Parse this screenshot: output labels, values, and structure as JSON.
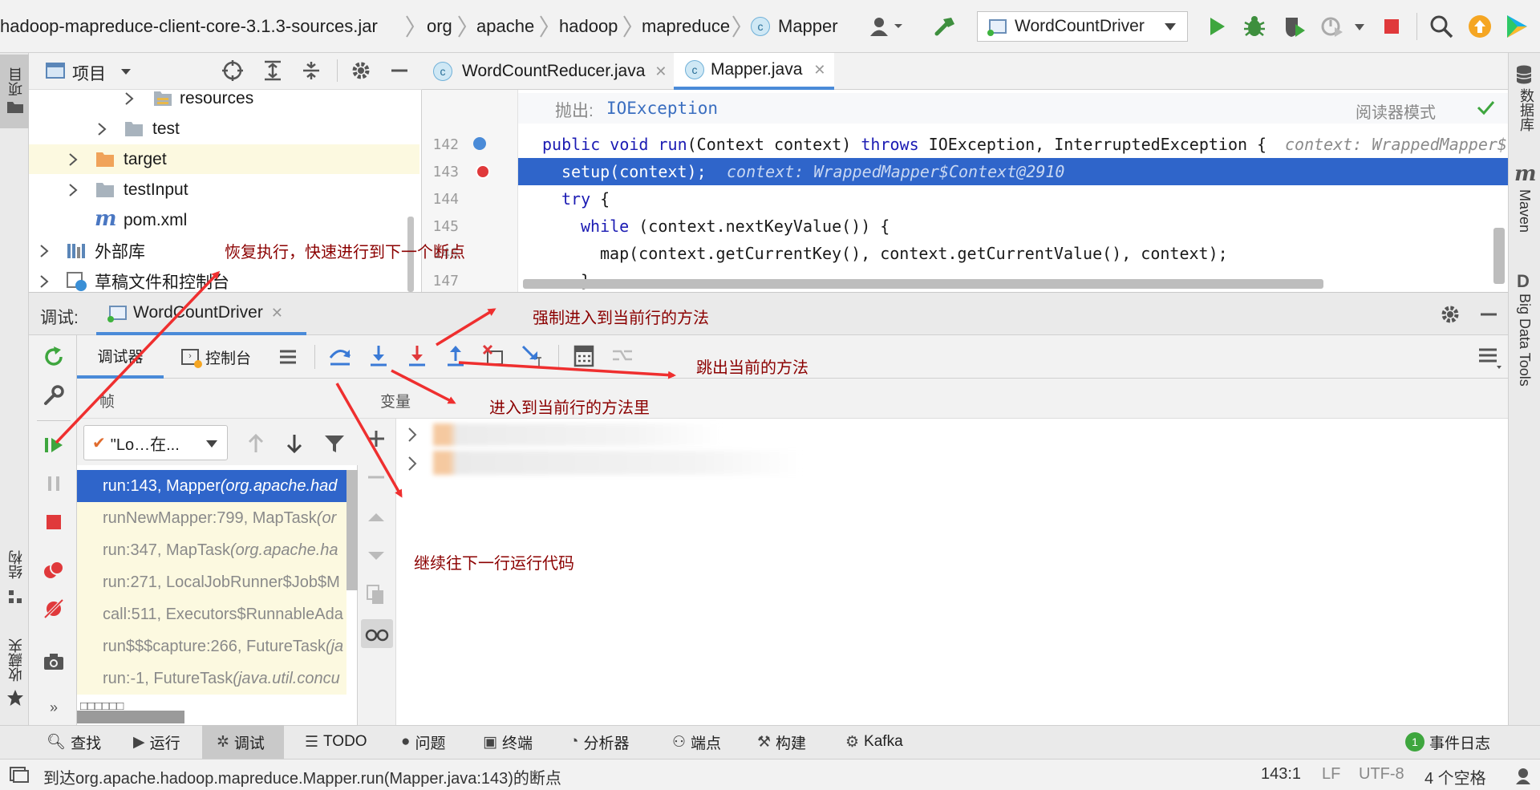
{
  "breadcrumb": {
    "items": [
      "hadoop-mapreduce-client-core-3.1.3-sources.jar",
      "org",
      "apache",
      "hadoop",
      "mapreduce",
      "Mapper"
    ]
  },
  "run_config": {
    "label": "WordCountDriver"
  },
  "project_panel": {
    "title": "项目",
    "tree": [
      {
        "label": "resources"
      },
      {
        "label": "test"
      },
      {
        "label": "target"
      },
      {
        "label": "testInput"
      },
      {
        "label": "pom.xml"
      },
      {
        "label": "外部库"
      },
      {
        "label": "草稿文件和控制台"
      }
    ]
  },
  "editor": {
    "tabs": [
      {
        "label": "WordCountReducer.java"
      },
      {
        "label": "Mapper.java"
      }
    ],
    "doc_throws_label": "抛出:",
    "doc_throws_value": "IOException",
    "reader_mode": "阅读器模式",
    "lines": [
      {
        "num": "142",
        "parts": [
          "public void run",
          "(Context context) ",
          "throws",
          " IOException, InterruptedException {"
        ],
        "hint": "context: WrappedMapper$"
      },
      {
        "num": "143",
        "text": "setup(context);",
        "hint": "context: WrappedMapper$Context@2910"
      },
      {
        "num": "144",
        "kw": "try",
        "text": " {"
      },
      {
        "num": "145",
        "kw": "while",
        "text": " (context.nextKeyValue()) {"
      },
      {
        "num": "146",
        "text": "map(context.getCurrentKey(), context.getCurrentValue(), context);"
      },
      {
        "num": "147",
        "text": "}"
      }
    ]
  },
  "debug": {
    "label": "调试:",
    "session_tab": "WordCountDriver",
    "tab_debugger": "调试器",
    "tab_console": "控制台",
    "frames_header": "帧",
    "variables_header": "变量",
    "thread_select": "\"Lo…在...",
    "frames": [
      {
        "method": "run:143, Mapper ",
        "cls": "(org.apache.had"
      },
      {
        "method": "runNewMapper:799, MapTask ",
        "cls": "(or"
      },
      {
        "method": "run:347, MapTask ",
        "cls": "(org.apache.ha"
      },
      {
        "method": "run:271, LocalJobRunner$Job$M",
        "cls": ""
      },
      {
        "method": "call:511, Executors$RunnableAda",
        "cls": ""
      },
      {
        "method": "run$$$capture:266, FutureTask ",
        "cls": "(ja"
      },
      {
        "method": "run:-1, FutureTask ",
        "cls": "(java.util.concu"
      }
    ],
    "frames_footer": "□□□□□□"
  },
  "annotations": {
    "resume": "恢复执行，快速进行到下一个断点",
    "force_step_into": "强制进入到当前行的方法",
    "step_out": "跳出当前的方法",
    "step_into": "进入到当前行的方法里",
    "step_over": "继续往下一行运行代码"
  },
  "right_sidebar": {
    "database": "数据库",
    "maven": "Maven",
    "big_data": "Big Data Tools"
  },
  "left_sidebar": {
    "project": "项目",
    "structure": "结构",
    "favorites": "收藏夹"
  },
  "bottom_tabs": [
    "查找",
    "运行",
    "调试",
    "TODO",
    "问题",
    "终端",
    "分析器",
    "端点",
    "构建",
    "Kafka"
  ],
  "event_log": {
    "count": "1",
    "label": "事件日志"
  },
  "status_bar": {
    "message": "到达org.apache.hadoop.mapreduce.Mapper.run(Mapper.java:143)的断点",
    "position": "143:1",
    "line_sep": "LF",
    "encoding": "UTF-8",
    "indent": "4 个空格"
  },
  "colors": {
    "accent": "#2f65ca",
    "annotation": "#8b0000",
    "arrow": "#ef2f2f"
  }
}
